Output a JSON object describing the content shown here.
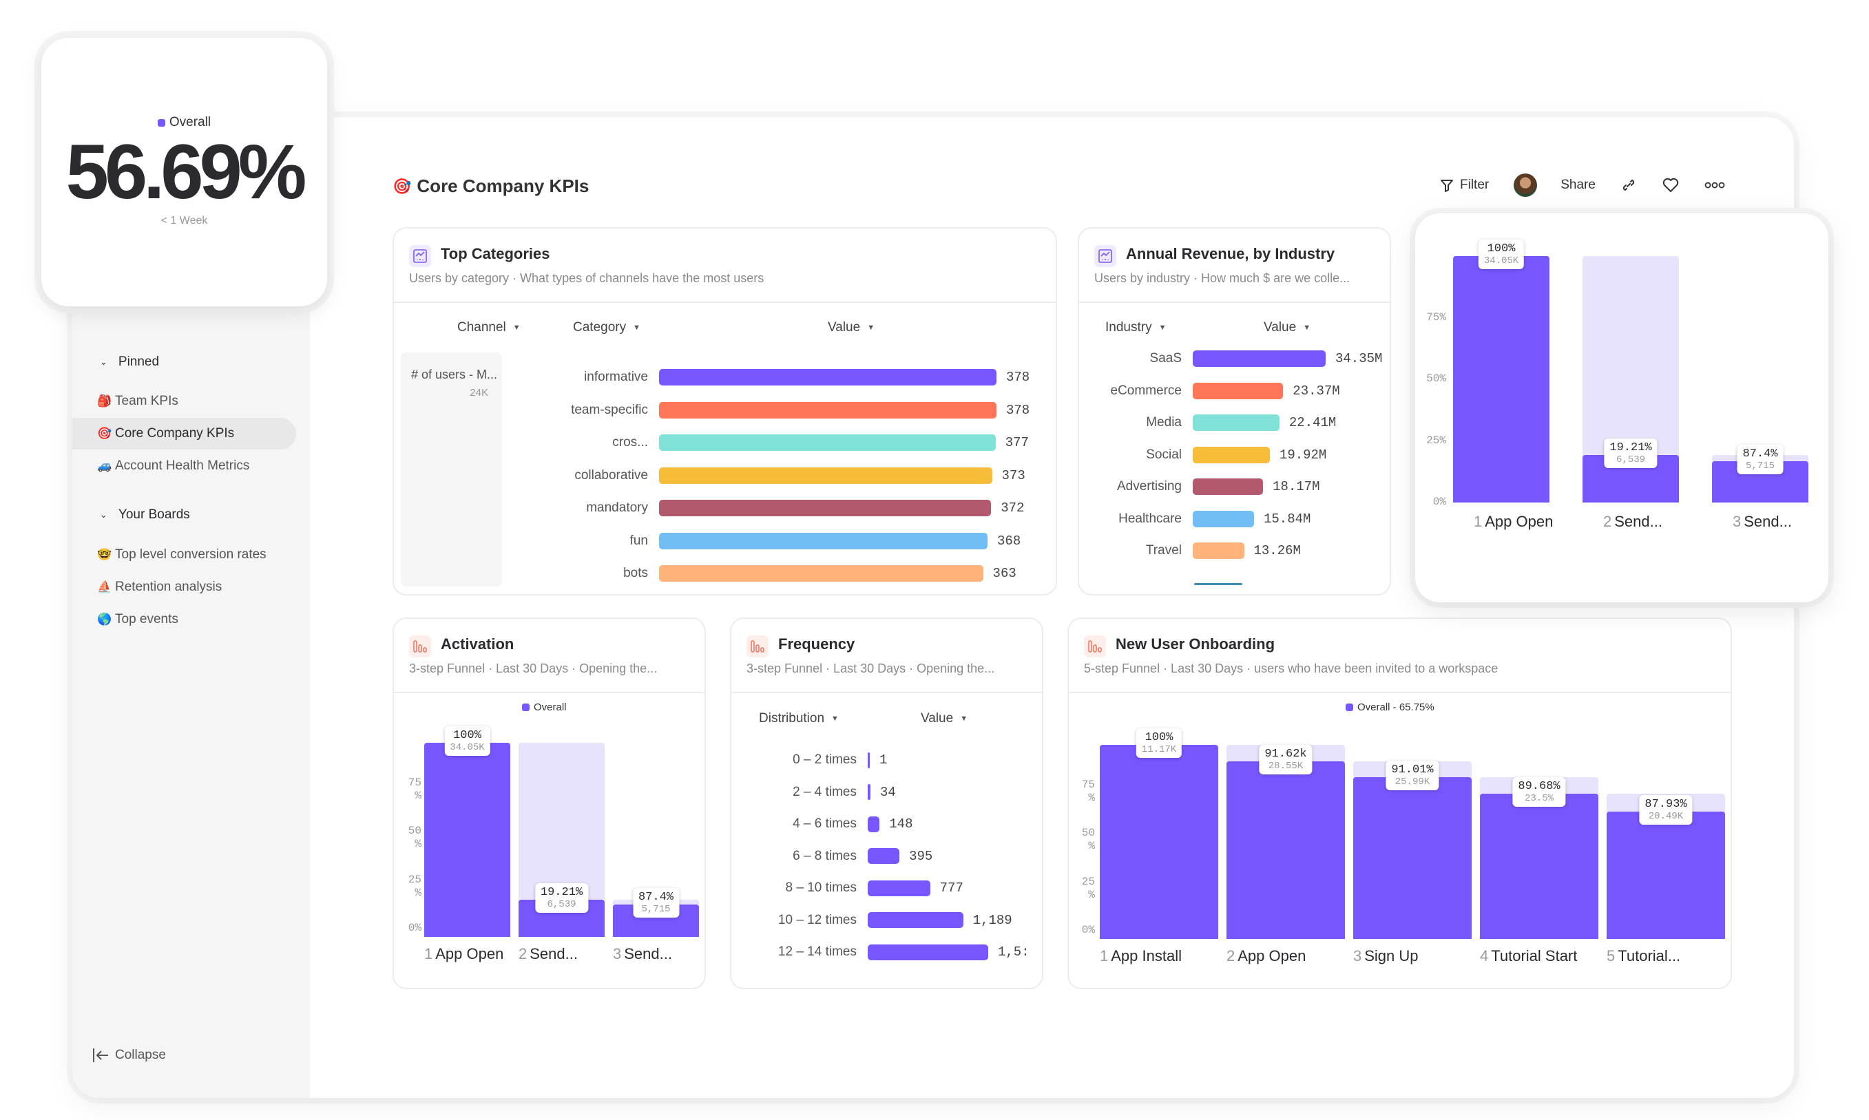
{
  "kpi_card": {
    "legend": "Overall",
    "value": "56.69%",
    "subtitle": "< 1 Week"
  },
  "board": {
    "title": "Core Company KPIs",
    "title_emoji": "🎯"
  },
  "toolbar": {
    "filter_label": "Filter",
    "share_label": "Share"
  },
  "sidebar": {
    "top_item": {
      "emoji": "⛵",
      "label": "Retention analysis"
    },
    "sections": [
      {
        "title": "Pinned",
        "items": [
          {
            "emoji": "🎒",
            "label": "Team KPIs"
          },
          {
            "emoji": "🎯",
            "label": "Core Company KPIs",
            "active": true
          },
          {
            "emoji": "🚙",
            "label": "Account Health Metrics"
          }
        ]
      },
      {
        "title": "Your Boards",
        "items": [
          {
            "emoji": "🤓",
            "label": "Top level conversion rates"
          },
          {
            "emoji": "⛵",
            "label": "Retention analysis"
          },
          {
            "emoji": "🌎",
            "label": "Top events"
          }
        ]
      }
    ],
    "collapse_label": "Collapse"
  },
  "colors": {
    "accent": "#7856ff",
    "accent_light": "#e8e3fd",
    "palette": [
      "#7856ff",
      "#ff7557",
      "#80e1d9",
      "#f8bc3b",
      "#b2596e",
      "#72bef4",
      "#ffb27a"
    ]
  },
  "chart_data": [
    {
      "id": "top_categories",
      "type": "bar",
      "orientation": "horizontal",
      "title": "Top Categories",
      "subtitle": "Users by category · What types of channels have the most users",
      "columns": [
        "Channel",
        "Category",
        "Value"
      ],
      "channel": {
        "label": "# of users - M...",
        "value": "24K"
      },
      "categories": [
        "informative",
        "team-specific",
        "cros...",
        "collaborative",
        "mandatory",
        "fun",
        "bots"
      ],
      "values": [
        378,
        378,
        377,
        373,
        372,
        368,
        363
      ],
      "value_labels": [
        "378",
        "378",
        "377",
        "373",
        "372",
        "368",
        "363"
      ],
      "xlim": [
        0,
        378
      ]
    },
    {
      "id": "annual_revenue",
      "type": "bar",
      "orientation": "horizontal",
      "title": "Annual Revenue, by Industry",
      "subtitle": "Users by industry · How much $ are we colle...",
      "columns": [
        "Industry",
        "Value"
      ],
      "categories": [
        "SaaS",
        "eCommerce",
        "Media",
        "Social",
        "Advertising",
        "Healthcare",
        "Travel"
      ],
      "values": [
        34.35,
        23.37,
        22.41,
        19.92,
        18.17,
        15.84,
        13.26
      ],
      "value_labels": [
        "34.35M",
        "23.37M",
        "22.41M",
        "19.92M",
        "18.17M",
        "15.84M",
        "13.26M"
      ],
      "unit": "M",
      "xlim": [
        0,
        34.35
      ]
    },
    {
      "id": "funnel_float",
      "type": "bar",
      "title": "",
      "categories": [
        "App Open",
        "Send...",
        "Send..."
      ],
      "values": [
        100,
        19.21,
        16.79
      ],
      "step_conversion_labels": [
        "100%",
        "19.21%",
        "87.4%"
      ],
      "count_labels": [
        "34.05K",
        "6,539",
        "5,715"
      ],
      "previous_step": [
        100,
        100,
        19.21
      ],
      "yticks": [
        "0%",
        "25%",
        "50%",
        "75%"
      ],
      "ylim": [
        0,
        100
      ]
    },
    {
      "id": "activation",
      "type": "bar",
      "title": "Activation",
      "subtitle": "3-step Funnel · Last 30 Days · Opening the...",
      "legend": "Overall",
      "categories": [
        "App Open",
        "Send...",
        "Send..."
      ],
      "values": [
        100,
        19.21,
        16.79
      ],
      "step_conversion_labels": [
        "100%",
        "19.21%",
        "87.4%"
      ],
      "count_labels": [
        "34.05K",
        "6,539",
        "5,715"
      ],
      "previous_step": [
        100,
        100,
        19.21
      ],
      "yticks": [
        "0%",
        "25 %",
        "50 %",
        "75 %"
      ],
      "ylim": [
        0,
        100
      ]
    },
    {
      "id": "frequency",
      "type": "bar",
      "orientation": "horizontal",
      "title": "Frequency",
      "subtitle": "3-step Funnel · Last 30 Days · Opening the...",
      "columns": [
        "Distribution",
        "Value"
      ],
      "categories": [
        "0 – 2 times",
        "2 – 4 times",
        "4 – 6 times",
        "6 – 8 times",
        "8 – 10 times",
        "10 – 12 times",
        "12 – 14 times"
      ],
      "values": [
        1,
        34,
        148,
        395,
        777,
        1189,
        1500
      ],
      "value_labels": [
        "1",
        "34",
        "148",
        "395",
        "777",
        "1,189",
        "1,5:"
      ],
      "xlim": [
        0,
        1500
      ]
    },
    {
      "id": "new_user_onboarding",
      "type": "bar",
      "title": "New User Onboarding",
      "subtitle": "5-step Funnel · Last 30 Days · users who have been invited to a workspace",
      "legend": "Overall - 65.75%",
      "categories": [
        "App Install",
        "App Open",
        "Sign Up",
        "Tutorial Start",
        "Tutorial..."
      ],
      "values": [
        100,
        91.62,
        83.4,
        74.8,
        65.75
      ],
      "step_conversion_labels": [
        "100%",
        "91.62k",
        "91.01%",
        "89.68%",
        "87.93%"
      ],
      "count_labels": [
        "11.17K",
        "28.55K",
        "25.99K",
        "23.5%",
        "20.49K"
      ],
      "previous_step": [
        100,
        100,
        91.62,
        83.4,
        74.8
      ],
      "yticks": [
        "0%",
        "25 %",
        "50 %",
        "75 %"
      ],
      "ylim": [
        0,
        100
      ]
    }
  ]
}
